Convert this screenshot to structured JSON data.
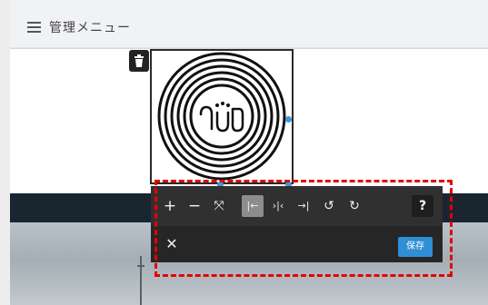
{
  "header": {
    "title": "管理メニュー",
    "menu_icon": "hamburger-icon"
  },
  "image": {
    "logo_text": "ՈՍՕ",
    "delete_icon": "trash-icon"
  },
  "toolbar": {
    "buttons": [
      {
        "name": "zoom-in",
        "glyph": "+",
        "active": false
      },
      {
        "name": "zoom-out",
        "glyph": "−",
        "active": false
      },
      {
        "name": "fit",
        "glyph": "⤧",
        "active": false
      },
      {
        "name": "align-left",
        "glyph": "|←",
        "active": true
      },
      {
        "name": "align-center",
        "glyph": "›|‹",
        "active": false
      },
      {
        "name": "align-right",
        "glyph": "→|",
        "active": false
      },
      {
        "name": "rotate-left",
        "glyph": "↺",
        "active": false
      },
      {
        "name": "rotate-right",
        "glyph": "↻",
        "active": false
      }
    ],
    "help_label": "?",
    "close_label": "✕",
    "save_label": "保存"
  },
  "colors": {
    "accent": "#2f8fd5",
    "annotation": "#e60000",
    "handle": "#3b9ad9"
  }
}
